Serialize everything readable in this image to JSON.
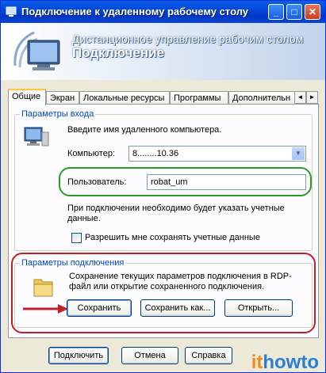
{
  "window": {
    "title": "Подключение к удаленному рабочему столу",
    "minimize_glyph": "_",
    "maximize_glyph": "□",
    "close_glyph": "✕"
  },
  "banner": {
    "subtitle": "Дистанционное управление рабочим столом",
    "title": "Подключение"
  },
  "tabs": [
    {
      "label": "Общие",
      "active": true
    },
    {
      "label": "Экран",
      "active": false
    },
    {
      "label": "Локальные ресурсы",
      "active": false
    },
    {
      "label": "Программы",
      "active": false
    },
    {
      "label": "Дополнительн",
      "active": false
    }
  ],
  "tab_scroll": {
    "left": "◄",
    "right": "►"
  },
  "logon": {
    "legend": "Параметры входа",
    "instruction": "Введите имя удаленного компьютера.",
    "computer_label": "Компьютер:",
    "computer_value": "8........10.36",
    "user_label": "Пользователь:",
    "user_value": "robat_um",
    "note": "При подключении необходимо будет указать учетные данные.",
    "save_credentials_label": "Разрешить мне сохранять учетные данные",
    "save_credentials_checked": false
  },
  "connection": {
    "legend": "Параметры подключения",
    "description": "Сохранение текущих параметров подключения в RDP-файл или открытие сохраненного подключения.",
    "save_button": "Сохранить",
    "save_as_button": "Сохранить как...",
    "open_button": "Открыть..."
  },
  "footer": {
    "connect_button": "Подключить",
    "cancel_button": "Отмена",
    "help_button": "Справка"
  },
  "watermark": {
    "part1": "it",
    "part2": "howto"
  },
  "colors": {
    "annotation_green": "#2a9a2a",
    "annotation_red": "#c0202a",
    "group_label_blue": "#0046d5",
    "watermark_orange": "#f28a1a",
    "watermark_blue": "#2a7fd0"
  }
}
